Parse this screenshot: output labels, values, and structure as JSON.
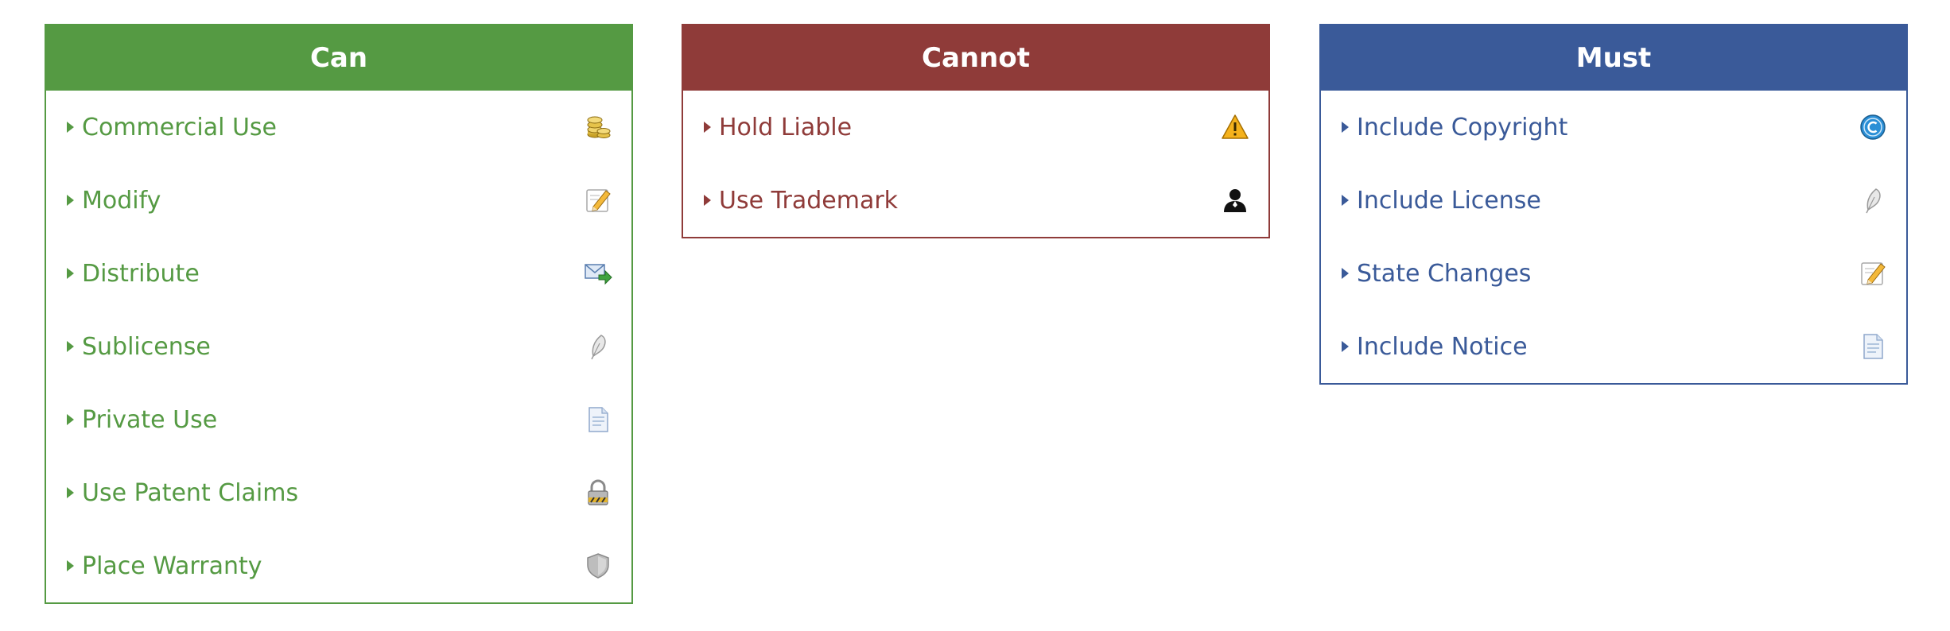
{
  "colors": {
    "can": "#559a43",
    "cannot": "#8f3b39",
    "must": "#3a5a99"
  },
  "panels": {
    "can": {
      "title": "Can",
      "items": [
        {
          "label": "Commercial Use",
          "icon": "coins-icon"
        },
        {
          "label": "Modify",
          "icon": "pencil-note-icon"
        },
        {
          "label": "Distribute",
          "icon": "mail-forward-icon"
        },
        {
          "label": "Sublicense",
          "icon": "feather-icon"
        },
        {
          "label": "Private Use",
          "icon": "document-icon"
        },
        {
          "label": "Use Patent Claims",
          "icon": "lock-icon"
        },
        {
          "label": "Place Warranty",
          "icon": "shield-icon"
        }
      ]
    },
    "cannot": {
      "title": "Cannot",
      "items": [
        {
          "label": "Hold Liable",
          "icon": "warning-icon"
        },
        {
          "label": "Use Trademark",
          "icon": "user-silhouette-icon"
        }
      ]
    },
    "must": {
      "title": "Must",
      "items": [
        {
          "label": "Include Copyright",
          "icon": "copyright-icon"
        },
        {
          "label": "Include License",
          "icon": "feather-icon"
        },
        {
          "label": "State Changes",
          "icon": "pencil-note-icon"
        },
        {
          "label": "Include Notice",
          "icon": "document-icon"
        }
      ]
    }
  }
}
